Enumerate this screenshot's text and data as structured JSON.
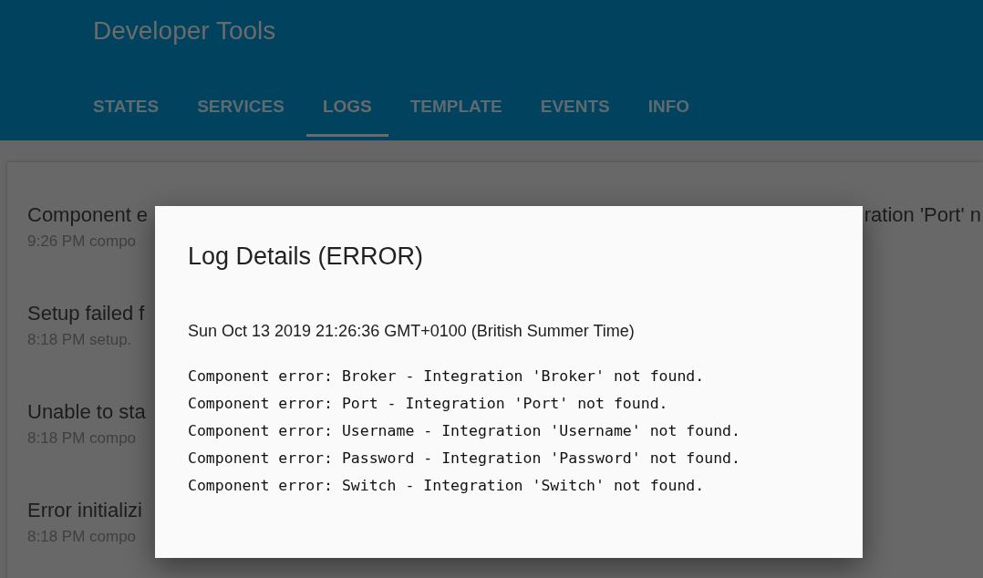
{
  "header": {
    "title": "Developer Tools"
  },
  "tabs": [
    {
      "label": "STATES",
      "selected": false
    },
    {
      "label": "SERVICES",
      "selected": false
    },
    {
      "label": "LOGS",
      "selected": true
    },
    {
      "label": "TEMPLATE",
      "selected": false
    },
    {
      "label": "EVENTS",
      "selected": false
    },
    {
      "label": "INFO",
      "selected": false
    }
  ],
  "log_list": [
    {
      "message": "Component e",
      "message_tail": "ration 'Port' n",
      "detail": "9:26 PM compo"
    },
    {
      "message": "Setup failed f",
      "detail": "8:18 PM setup."
    },
    {
      "message": "Unable to sta",
      "detail": "8:18 PM compo"
    },
    {
      "message": "Error initializi",
      "detail": "8:18 PM compo"
    }
  ],
  "dialog": {
    "title": "Log Details (ERROR)",
    "timestamp": "Sun Oct 13 2019 21:26:36 GMT+0100 (British Summer Time)",
    "lines": [
      "Component error: Broker - Integration 'Broker' not found.",
      "Component error: Port - Integration 'Port' not found.",
      "Component error: Username - Integration 'Username' not found.",
      "Component error: Password - Integration 'Password' not found.",
      "Component error: Switch - Integration 'Switch' not found."
    ]
  }
}
